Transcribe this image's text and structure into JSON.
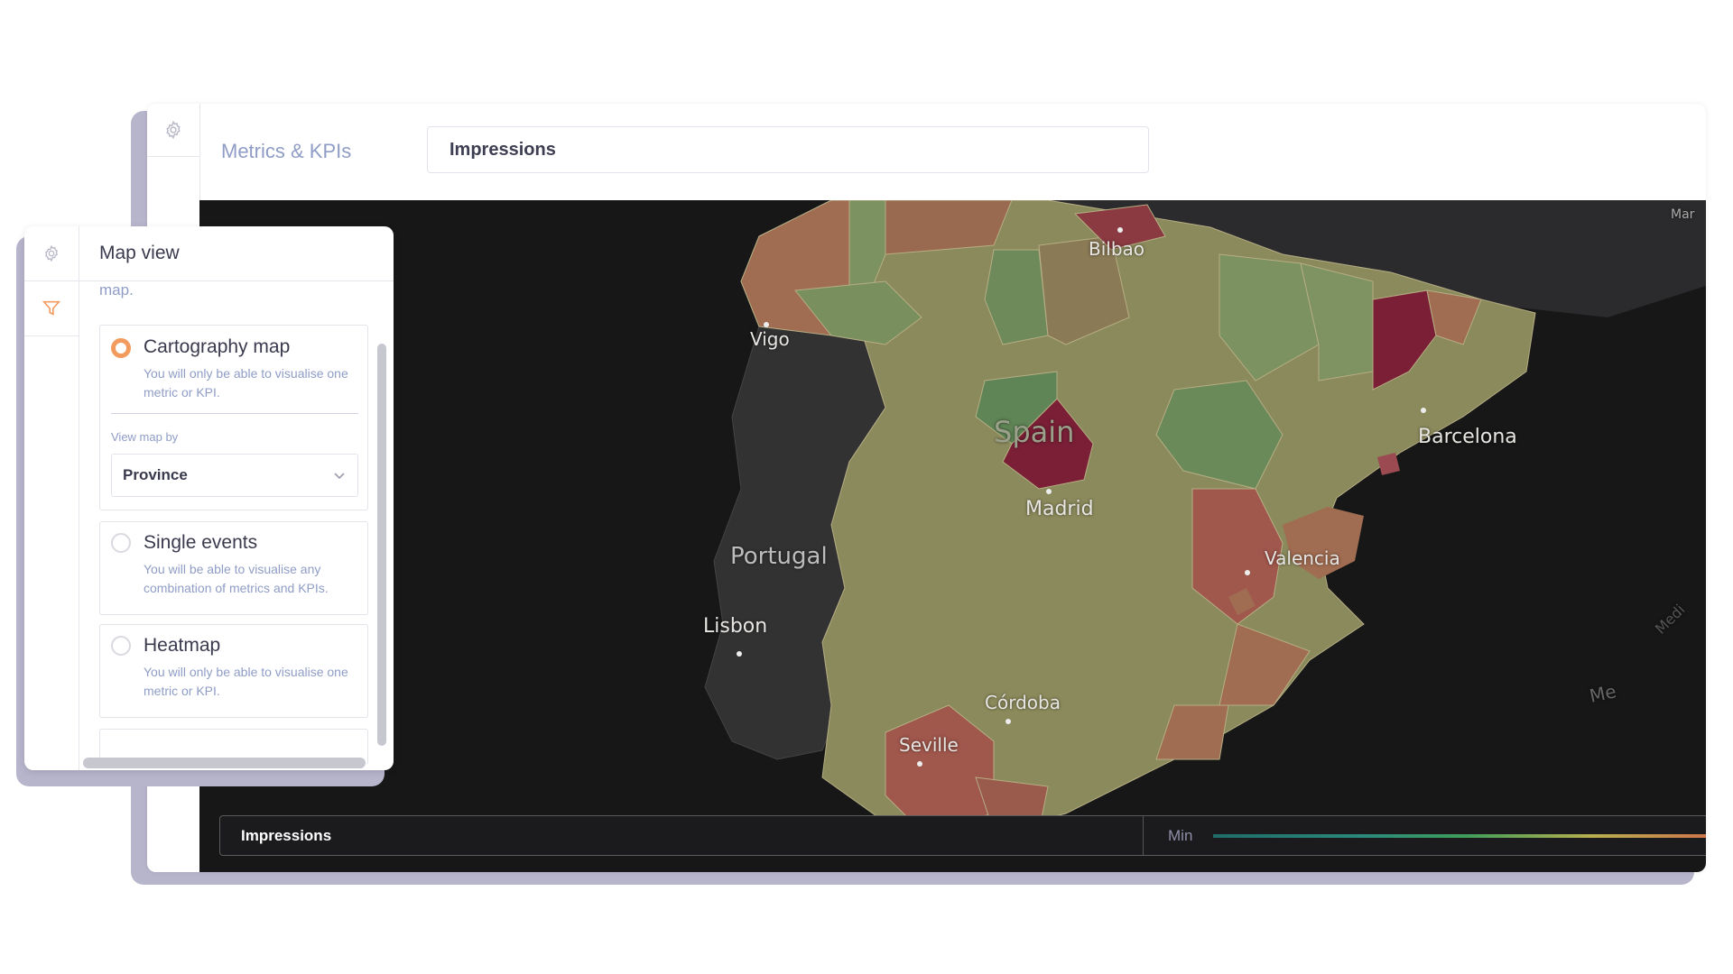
{
  "header": {
    "title": "Metrics & KPIs",
    "metric_value": "Impressions"
  },
  "panel": {
    "title": "Map view",
    "clipped_text": "map.",
    "options": [
      {
        "title": "Cartography map",
        "description": "You will only be able to visualise one metric or KPI.",
        "selected": true
      },
      {
        "title": "Single events",
        "description": "You will be able to visualise any combination of metrics and KPIs.",
        "selected": false
      },
      {
        "title": "Heatmap",
        "description": "You will only be able to visualise one metric or KPI.",
        "selected": false
      }
    ],
    "view_map_by_label": "View map by",
    "view_map_by_value": "Province"
  },
  "map": {
    "labels": {
      "spain": "Spain",
      "portugal": "Portugal",
      "bilbao": "Bilbao",
      "vigo": "Vigo",
      "barcelona": "Barcelona",
      "madrid": "Madrid",
      "valencia": "Valencia",
      "lisbon": "Lisbon",
      "cordoba": "Córdoba",
      "seville": "Seville",
      "mar": "Mar",
      "me": "Me",
      "medi": "Medi"
    }
  },
  "legend": {
    "metric": "Impressions",
    "min_label": "Min"
  },
  "colors": {
    "accent": "#f39b5e",
    "link": "#8f9dc6",
    "map_background": "#171717",
    "region_green": "#6e8a5a",
    "region_olive": "#8b8a5c",
    "region_salmon": "#a06c52",
    "region_maroon": "#7a1f36"
  }
}
